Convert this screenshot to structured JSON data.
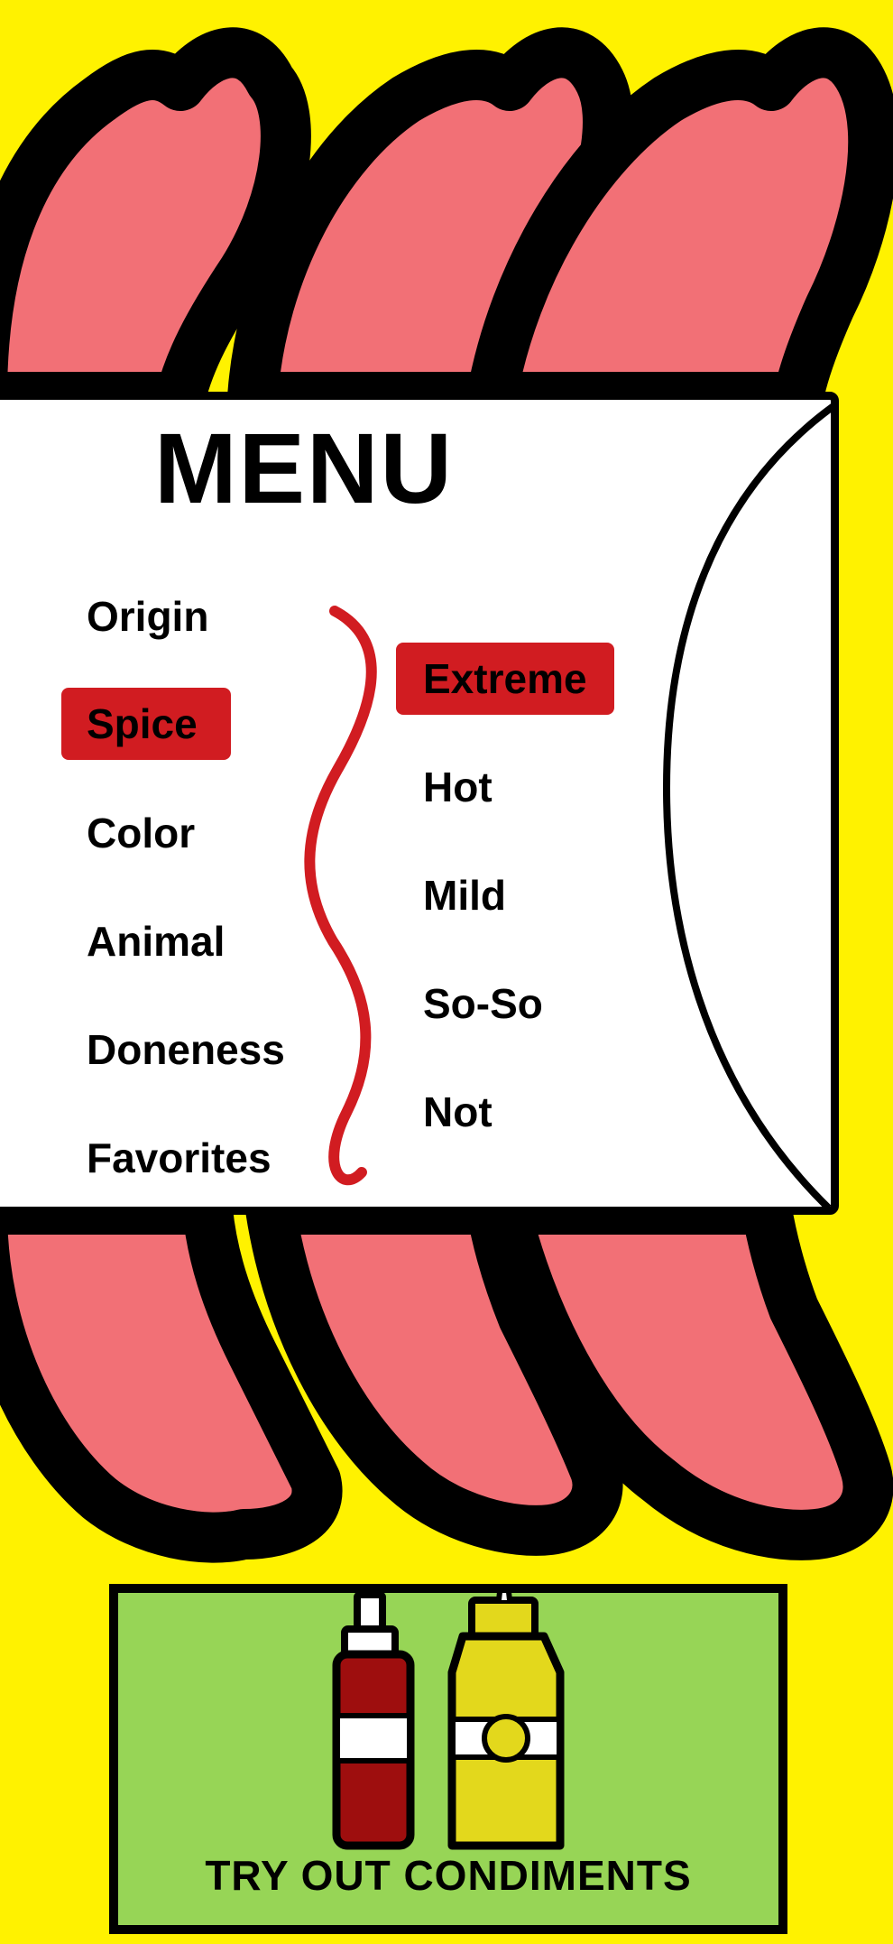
{
  "colors": {
    "background": "#fff200",
    "sausage": "#f27076",
    "outline": "#000000",
    "panel": "#ffffff",
    "accent_red": "#d11c21",
    "condiment_panel": "#97d556",
    "ketchup": "#9e0e0e",
    "mustard": "#e3d81c"
  },
  "menu": {
    "title": "MENU",
    "categories": [
      {
        "label": "Origin",
        "selected": false
      },
      {
        "label": "Spice",
        "selected": true
      },
      {
        "label": "Color",
        "selected": false
      },
      {
        "label": "Animal",
        "selected": false
      },
      {
        "label": "Doneness",
        "selected": false
      },
      {
        "label": "Favorites",
        "selected": false
      }
    ],
    "options": [
      {
        "label": "Extreme",
        "selected": true
      },
      {
        "label": "Hot",
        "selected": false
      },
      {
        "label": "Mild",
        "selected": false
      },
      {
        "label": "So-So",
        "selected": false
      },
      {
        "label": "Not",
        "selected": false
      }
    ]
  },
  "condiments": {
    "label": "TRY OUT CONDIMENTS",
    "icons": [
      "ketchup-bottle-icon",
      "mustard-bottle-icon"
    ]
  }
}
